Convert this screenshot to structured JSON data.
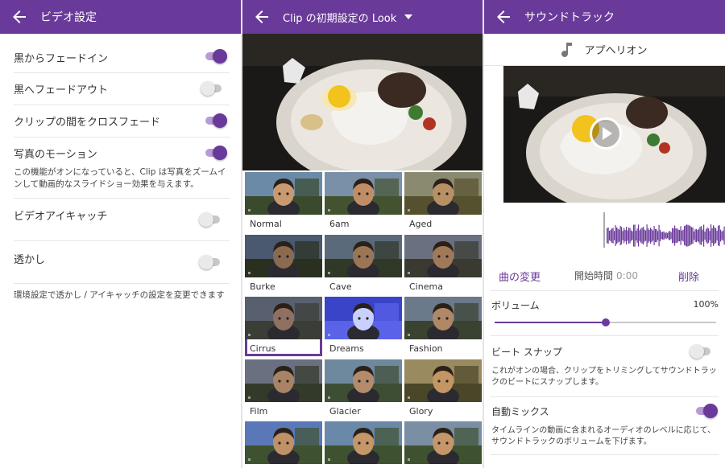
{
  "colors": {
    "accent": "#6a3a9a",
    "accent_light": "#b89ad6",
    "toggle_off": "#c8c8c8"
  },
  "video_settings": {
    "title": "ビデオ設定",
    "rows": [
      {
        "label": "黒からフェードイン",
        "on": true
      },
      {
        "label": "黒へフェードアウト",
        "on": false
      },
      {
        "label": "クリップの間をクロスフェード",
        "on": true
      },
      {
        "label": "写真のモーション",
        "on": true,
        "description": "この機能がオンになっていると、Clip は写真をズームインして動画的なスライドショー効果を与えます。"
      },
      {
        "label": "ビデオアイキャッチ",
        "on": false,
        "disabled": true
      },
      {
        "label": "透かし",
        "on": false,
        "disabled": true
      }
    ],
    "note": "環境設定で透かし / アイキャッチの設定を変更できます"
  },
  "look_picker": {
    "title": "Clip の初期設定の Look",
    "looks": [
      {
        "name": "Normal"
      },
      {
        "name": "6am"
      },
      {
        "name": "Aged"
      },
      {
        "name": "Burke"
      },
      {
        "name": "Cave"
      },
      {
        "name": "Cinema"
      },
      {
        "name": "Cirrus",
        "selected": true
      },
      {
        "name": "Dreams"
      },
      {
        "name": "Fashion"
      },
      {
        "name": "Film"
      },
      {
        "name": "Glacier"
      },
      {
        "name": "Glory"
      },
      {
        "name": ""
      },
      {
        "name": ""
      },
      {
        "name": ""
      }
    ]
  },
  "soundtrack": {
    "title": "サウンドトラック",
    "song": "アプヘリオン",
    "change_label": "曲の変更",
    "start_label": "開始時間",
    "start_value": "0:00",
    "delete_label": "削除",
    "volume_label": "ボリューム",
    "volume_value": "100%",
    "volume_fraction": 0.5,
    "beat_snap_label": "ビート スナップ",
    "beat_snap_on": false,
    "beat_snap_desc": "これがオンの場合、クリップをトリミングしてサウンドトラックのビートにスナップします。",
    "auto_mix_label": "自動ミックス",
    "auto_mix_on": true,
    "auto_mix_desc": "タイムラインの動画に含まれるオーディオのレベルに応じて、サウンドトラックのボリュームを下げます。"
  }
}
